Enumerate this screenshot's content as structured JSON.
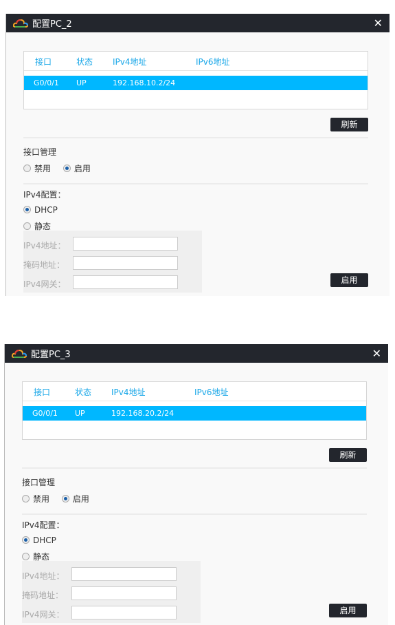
{
  "dialogs": [
    {
      "title": "配置PC_2",
      "columns": [
        "接口",
        "状态",
        "IPv4地址",
        "IPv6地址"
      ],
      "row": {
        "interface": "G0/0/1",
        "status": "UP",
        "ipv4": "192.168.10.2/24",
        "ipv6": ""
      },
      "refresh": "刷新",
      "iface_mgmt": "接口管理",
      "disable": "禁用",
      "enable": "启用",
      "iface_state": "启用",
      "ipv4_config": "IPv4配置：",
      "dhcp": "DHCP",
      "static": "静态",
      "ipv4_mode": "DHCP",
      "ipv4_addr_label": "IPv4地址：",
      "mask_label": "掩码地址：",
      "gateway_label": "IPv4网关：",
      "ipv4_addr": "",
      "mask": "",
      "gateway": "",
      "apply": "启用"
    },
    {
      "title": "配置PC_3",
      "columns": [
        "接口",
        "状态",
        "IPv4地址",
        "IPv6地址"
      ],
      "row": {
        "interface": "G0/0/1",
        "status": "UP",
        "ipv4": "192.168.20.2/24",
        "ipv6": ""
      },
      "refresh": "刷新",
      "iface_mgmt": "接口管理",
      "disable": "禁用",
      "enable": "启用",
      "iface_state": "启用",
      "ipv4_config": "IPv4配置：",
      "dhcp": "DHCP",
      "static": "静态",
      "ipv4_mode": "DHCP",
      "ipv4_addr_label": "IPv4地址：",
      "mask_label": "掩码地址：",
      "gateway_label": "IPv4网关：",
      "ipv4_addr": "",
      "mask": "",
      "gateway": "",
      "apply": "启用"
    }
  ],
  "colors": {
    "titlebar": "#23262d",
    "header_text": "#19a7e8",
    "selected_row": "#00b7ff"
  },
  "icons": {
    "logo": "cloud-logo-icon",
    "close": "close-icon"
  }
}
